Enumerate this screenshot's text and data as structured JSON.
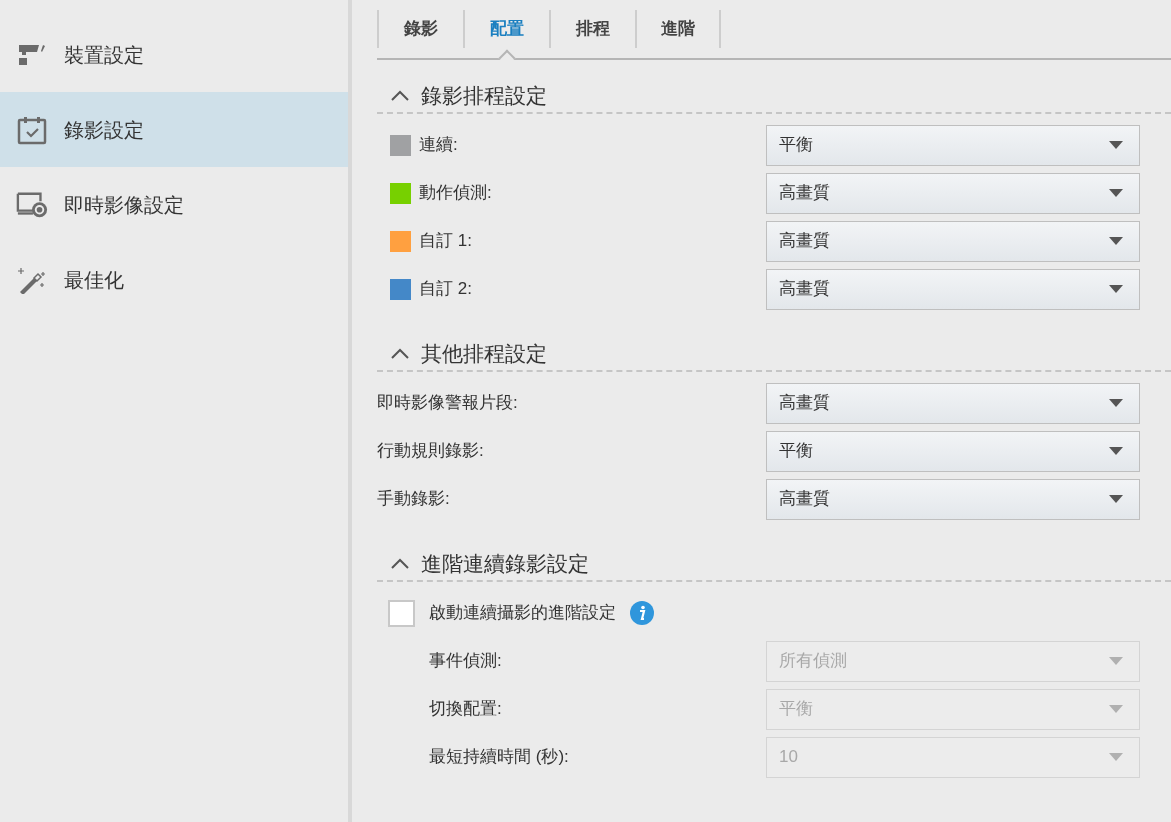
{
  "sidebar": {
    "items": [
      {
        "kind": "camera",
        "label": "裝置設定",
        "selected": false
      },
      {
        "kind": "calendar",
        "label": "錄影設定",
        "selected": true
      },
      {
        "kind": "monitor",
        "label": "即時影像設定",
        "selected": false
      },
      {
        "kind": "wand",
        "label": "最佳化",
        "selected": false
      }
    ]
  },
  "tabs": [
    {
      "label": "錄影",
      "selected": false
    },
    {
      "label": "配置",
      "selected": true
    },
    {
      "label": "排程",
      "selected": false
    },
    {
      "label": "進階",
      "selected": false
    }
  ],
  "sections": [
    {
      "title": "錄影排程設定",
      "expanded": true,
      "rows": [
        {
          "label": "連續:",
          "color": "#a0a1a3",
          "value": "平衡",
          "disabled": false
        },
        {
          "label": "動作偵測:",
          "color": "#77d000",
          "value": "高畫質",
          "disabled": false
        },
        {
          "label": "自訂 1:",
          "color": "#ffa040",
          "value": "高畫質",
          "disabled": false
        },
        {
          "label": "自訂 2:",
          "color": "#4488c8",
          "value": "高畫質",
          "disabled": false
        }
      ]
    },
    {
      "title": "其他排程設定",
      "expanded": true,
      "rows": [
        {
          "label": "即時影像警報片段:",
          "value": "高畫質",
          "disabled": false
        },
        {
          "label": "行動規則錄影:",
          "value": "平衡",
          "disabled": false
        },
        {
          "label": "手動錄影:",
          "value": "高畫質",
          "disabled": false
        }
      ]
    },
    {
      "title": "進階連續錄影設定",
      "expanded": true,
      "checkbox": {
        "label": "啟動連續攝影的進階設定",
        "checked": false
      },
      "rows": [
        {
          "label": "事件偵測:",
          "value": "所有偵測",
          "disabled": true
        },
        {
          "label": "切換配置:",
          "value": "平衡",
          "disabled": true
        },
        {
          "label": "最短持續時間 (秒):",
          "value": "10",
          "disabled": true
        }
      ]
    }
  ]
}
